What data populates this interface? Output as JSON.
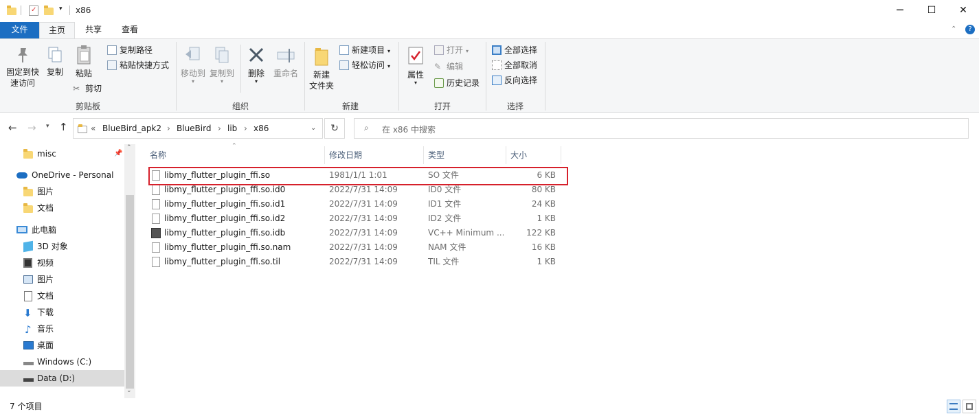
{
  "window": {
    "title": "x86",
    "controls": {
      "minimize": "─",
      "maximize": "☐",
      "close": "✕"
    }
  },
  "ribbon_tabs": [
    {
      "label": "文件"
    },
    {
      "label": "主页"
    },
    {
      "label": "共享"
    },
    {
      "label": "查看"
    }
  ],
  "ribbon": {
    "clipboard": {
      "group_label": "剪贴板",
      "pin_label_1": "固定到快",
      "pin_label_2": "速访问",
      "copy": "复制",
      "paste": "粘贴",
      "copy_path": "复制路径",
      "paste_shortcut": "粘贴快捷方式",
      "cut": "剪切"
    },
    "organize": {
      "group_label": "组织",
      "move_to": "移动到",
      "copy_to": "复制到",
      "delete": "删除",
      "rename": "重命名"
    },
    "new": {
      "group_label": "新建",
      "new_folder_1": "新建",
      "new_folder_2": "文件夹",
      "new_item": "新建项目",
      "easy_access": "轻松访问"
    },
    "open": {
      "group_label": "打开",
      "properties": "属性",
      "open": "打开",
      "edit": "编辑",
      "history": "历史记录"
    },
    "select": {
      "group_label": "选择",
      "select_all": "全部选择",
      "select_none": "全部取消",
      "invert": "反向选择"
    }
  },
  "address": {
    "prefix": "«",
    "crumbs": [
      "BlueBird_apk2",
      "BlueBird",
      "lib",
      "x86"
    ],
    "search_placeholder": "在 x86 中搜索"
  },
  "nav": {
    "misc": "misc",
    "onedrive": "OneDrive - Personal",
    "od_pictures": "图片",
    "od_docs": "文档",
    "this_pc": "此电脑",
    "objects3d": "3D 对象",
    "videos": "视频",
    "pictures": "图片",
    "documents": "文档",
    "downloads": "下载",
    "music": "音乐",
    "desktop": "桌面",
    "windows_c": "Windows (C:)",
    "data_d": "Data (D:)"
  },
  "columns": {
    "name": "名称",
    "date": "修改日期",
    "type": "类型",
    "size": "大小"
  },
  "files": [
    {
      "name": "libmy_flutter_plugin_ffi.so",
      "date": "1981/1/1 1:01",
      "type": "SO 文件",
      "size": "6 KB"
    },
    {
      "name": "libmy_flutter_plugin_ffi.so.id0",
      "date": "2022/7/31 14:09",
      "type": "ID0 文件",
      "size": "80 KB"
    },
    {
      "name": "libmy_flutter_plugin_ffi.so.id1",
      "date": "2022/7/31 14:09",
      "type": "ID1 文件",
      "size": "24 KB"
    },
    {
      "name": "libmy_flutter_plugin_ffi.so.id2",
      "date": "2022/7/31 14:09",
      "type": "ID2 文件",
      "size": "1 KB"
    },
    {
      "name": "libmy_flutter_plugin_ffi.so.idb",
      "date": "2022/7/31 14:09",
      "type": "VC++ Minimum ...",
      "size": "122 KB"
    },
    {
      "name": "libmy_flutter_plugin_ffi.so.nam",
      "date": "2022/7/31 14:09",
      "type": "NAM 文件",
      "size": "16 KB"
    },
    {
      "name": "libmy_flutter_plugin_ffi.so.til",
      "date": "2022/7/31 14:09",
      "type": "TIL 文件",
      "size": "1 KB"
    }
  ],
  "status": {
    "count": "7 个项目"
  },
  "colors": {
    "accent": "#1c6ec2",
    "highlight_box": "#d6202b",
    "folder": "#f8d775"
  }
}
